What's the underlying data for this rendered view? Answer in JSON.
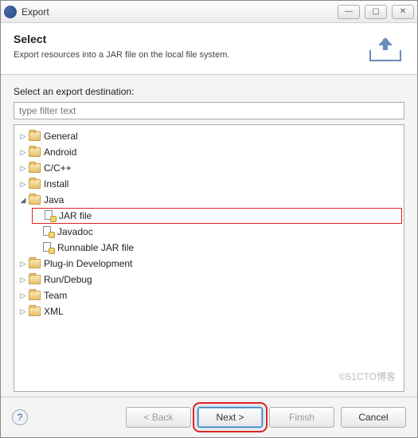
{
  "window": {
    "title": "Export"
  },
  "banner": {
    "heading": "Select",
    "description": "Export resources into a JAR file on the local file system."
  },
  "body": {
    "destination_label": "Select an export destination:",
    "filter_placeholder": "type filter text"
  },
  "tree": {
    "general": "General",
    "android": "Android",
    "ccpp": "C/C++",
    "install": "Install",
    "java": "Java",
    "jar_file": "JAR file",
    "javadoc": "Javadoc",
    "runnable_jar": "Runnable JAR file",
    "plugin_dev": "Plug-in Development",
    "run_debug": "Run/Debug",
    "team": "Team",
    "xml": "XML"
  },
  "watermark": "©51CTO博客",
  "footer": {
    "back": "< Back",
    "next": "Next >",
    "finish": "Finish",
    "cancel": "Cancel",
    "help": "?"
  }
}
